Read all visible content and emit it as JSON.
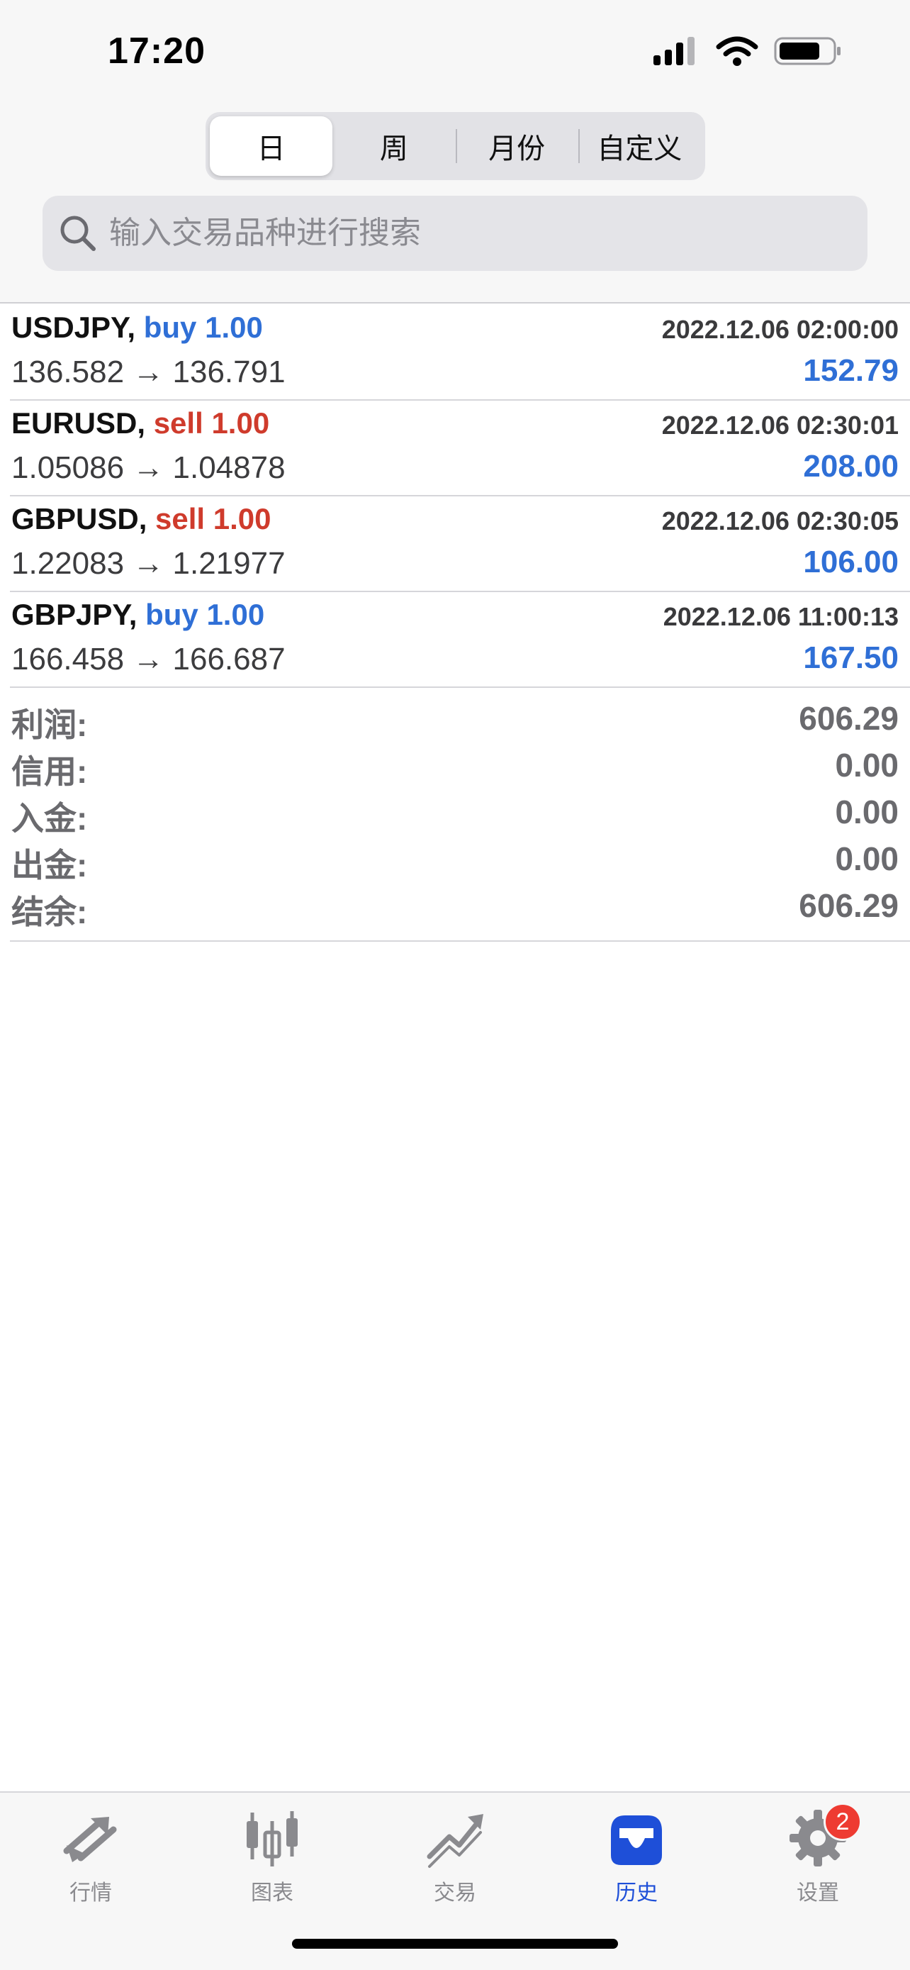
{
  "status_bar": {
    "time": "17:20"
  },
  "segments": [
    {
      "label": "日",
      "active": true
    },
    {
      "label": "周",
      "active": false
    },
    {
      "label": "月份",
      "active": false
    },
    {
      "label": "自定义",
      "active": false
    }
  ],
  "search": {
    "placeholder": "输入交易品种进行搜索"
  },
  "deals": [
    {
      "symbol": "USDJPY,",
      "side": "buy",
      "volume": "1.00",
      "datetime": "2022.12.06 02:00:00",
      "prices": "136.582 → 136.791",
      "profit": "152.79"
    },
    {
      "symbol": "EURUSD,",
      "side": "sell",
      "volume": "1.00",
      "datetime": "2022.12.06 02:30:01",
      "prices": "1.05086 → 1.04878",
      "profit": "208.00"
    },
    {
      "symbol": "GBPUSD,",
      "side": "sell",
      "volume": "1.00",
      "datetime": "2022.12.06 02:30:05",
      "prices": "1.22083 → 1.21977",
      "profit": "106.00"
    },
    {
      "symbol": "GBPJPY,",
      "side": "buy",
      "volume": "1.00",
      "datetime": "2022.12.06 11:00:13",
      "prices": "166.458 → 166.687",
      "profit": "167.50"
    }
  ],
  "summary": [
    {
      "label": "利润:",
      "value": "606.29"
    },
    {
      "label": "信用:",
      "value": "0.00"
    },
    {
      "label": "入金:",
      "value": "0.00"
    },
    {
      "label": "出金:",
      "value": "0.00"
    },
    {
      "label": "结余:",
      "value": "606.29"
    }
  ],
  "tabbar": {
    "tabs": [
      {
        "label": "行情",
        "icon": "quotes-arrows-icon",
        "active": false
      },
      {
        "label": "图表",
        "icon": "candlestick-chart-icon",
        "active": false
      },
      {
        "label": "交易",
        "icon": "trade-trend-icon",
        "active": false
      },
      {
        "label": "历史",
        "icon": "inbox-tray-icon",
        "active": true
      },
      {
        "label": "设置",
        "icon": "gear-icon",
        "active": false,
        "badge": "2"
      }
    ]
  },
  "colors": {
    "buy": "#2f6fd6",
    "sell": "#cf3b2c",
    "profit": "#2f6fd6",
    "active_tab": "#1e4fd8",
    "badge": "#ee3b32"
  }
}
